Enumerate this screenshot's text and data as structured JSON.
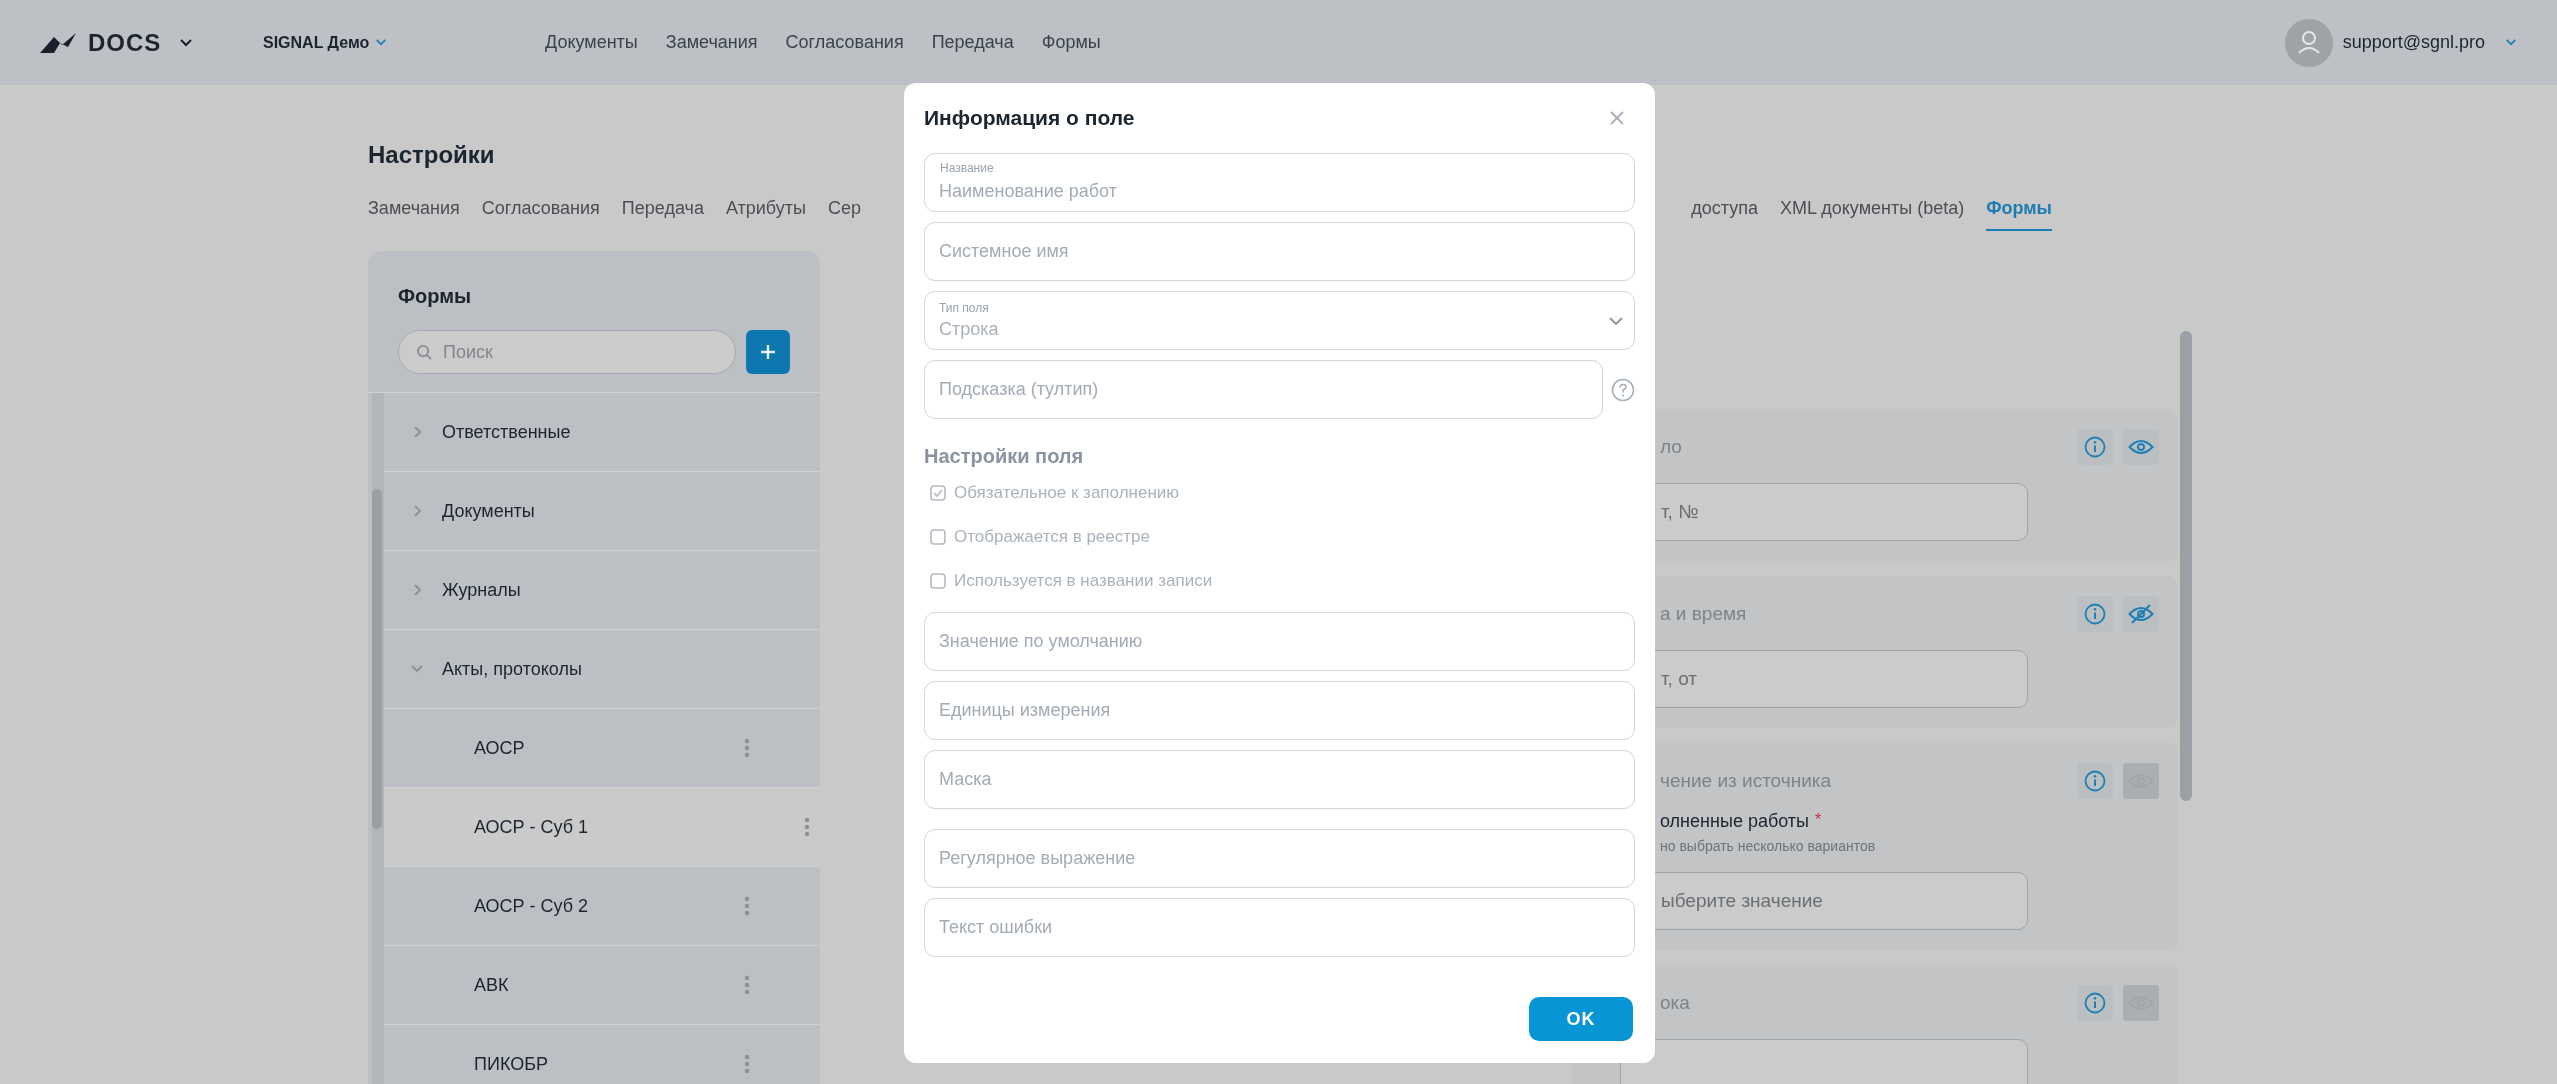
{
  "header": {
    "logo": "DOCS",
    "workspace": "SIGNAL Демо",
    "nav": [
      "Документы",
      "Замечания",
      "Согласования",
      "Передача",
      "Формы"
    ],
    "user": "support@sgnl.pro"
  },
  "settings": {
    "title": "Настройки",
    "tabs_left": [
      {
        "label": "Замечания",
        "selected": false
      },
      {
        "label": "Согласования",
        "selected": false
      },
      {
        "label": "Передача",
        "selected": false
      },
      {
        "label": "Атрибуты",
        "selected": false
      },
      {
        "label": "Сер",
        "selected": false
      }
    ],
    "tabs_right": [
      {
        "label": "доступа",
        "selected": false
      },
      {
        "label": "XML документы (beta)",
        "selected": false
      },
      {
        "label": "Формы",
        "selected": true
      }
    ]
  },
  "forms_panel": {
    "title": "Формы",
    "search": {
      "placeholder": "Поиск"
    },
    "items": [
      {
        "label": "Ответственные",
        "expanded": false
      },
      {
        "label": "Документы",
        "expanded": false
      },
      {
        "label": "Журналы",
        "expanded": false
      },
      {
        "label": "Акты, протоколы",
        "expanded": true,
        "children": [
          {
            "label": "АОСР",
            "selected": false
          },
          {
            "label": "АОСР - Суб 1",
            "selected": true
          },
          {
            "label": "АОСР - Суб 2",
            "selected": false
          },
          {
            "label": "АВК",
            "selected": false
          },
          {
            "label": "ПИКОБР",
            "selected": false
          }
        ]
      }
    ]
  },
  "field_cards": [
    {
      "title": "ло",
      "visible": true,
      "disabled": false,
      "input": "т, №"
    },
    {
      "title": "а и время",
      "visible": false,
      "disabled": false,
      "input": "т, от"
    },
    {
      "title": "чение из источника",
      "visible": true,
      "disabled": true,
      "label": "олненные работы",
      "required_mark": "*",
      "hint": "но выбрать несколько вариантов",
      "input": "ыберите значение"
    },
    {
      "title": "ока",
      "visible": true,
      "disabled": true
    }
  ],
  "dialog": {
    "title": "Информация о поле",
    "fields": [
      {
        "kind": "text",
        "label": "Название",
        "value": "Наименование работ"
      },
      {
        "kind": "text",
        "placeholder": "Системное имя"
      },
      {
        "kind": "select",
        "label": "Тип поля",
        "value": "Строка"
      },
      {
        "kind": "help",
        "placeholder": "Подсказка (тултип)"
      }
    ],
    "section": "Настройки поля",
    "checkboxes": [
      {
        "label": "Обязательное к заполнению",
        "checked": true,
        "disabled": true
      },
      {
        "label": "Отображается в реестре",
        "checked": false,
        "disabled": true
      },
      {
        "label": "Используется в названии записи",
        "checked": false,
        "disabled": true
      }
    ],
    "more_fields": [
      {
        "placeholder": "Значение по умолчанию"
      },
      {
        "placeholder": "Единицы измерения"
      },
      {
        "placeholder": "Маска"
      }
    ],
    "validation_fields": [
      {
        "placeholder": "Регулярное выражение"
      },
      {
        "placeholder": "Текст ошибки"
      }
    ],
    "ok": "OK"
  }
}
